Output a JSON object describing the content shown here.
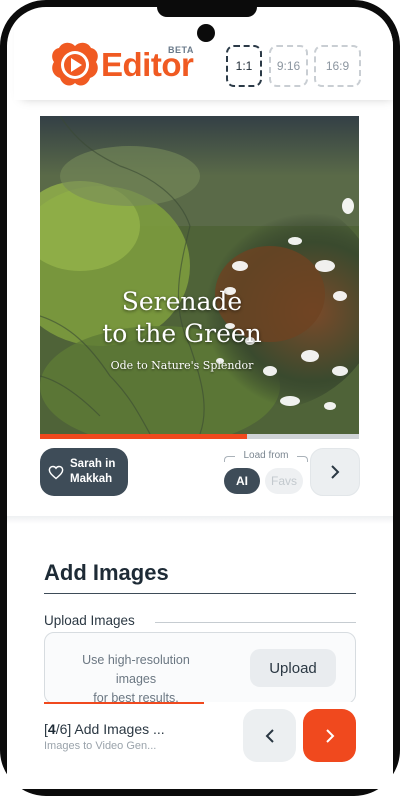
{
  "app": {
    "name": "Editor",
    "badge": "BETA"
  },
  "aspect_ratios": [
    {
      "label": "1:1",
      "active": true
    },
    {
      "label": "9:16",
      "active": false
    },
    {
      "label": "16:9",
      "active": false
    }
  ],
  "preview": {
    "title_line1": "Serenade",
    "title_line2": "to the Green",
    "subtitle": "Ode to Nature's Splendor",
    "progress": 0.65
  },
  "controls": {
    "playlist_line1": "Sarah in",
    "playlist_line2": "Makkah",
    "load_from_label": "Load from",
    "source_ai": "AI",
    "source_favs": "Favs"
  },
  "section": {
    "title": "Add Images",
    "upload_label": "Upload Images",
    "upload_hint_line1": "Use high-resolution images",
    "upload_hint_line2": "for best results.",
    "upload_button": "Upload"
  },
  "footer": {
    "step_current": "4",
    "step_total": "6",
    "step_title": "Add Images ...",
    "step_subtitle": "Images to Video Gen..."
  },
  "colors": {
    "accent": "#f0491e",
    "dark": "#3e4c58"
  }
}
